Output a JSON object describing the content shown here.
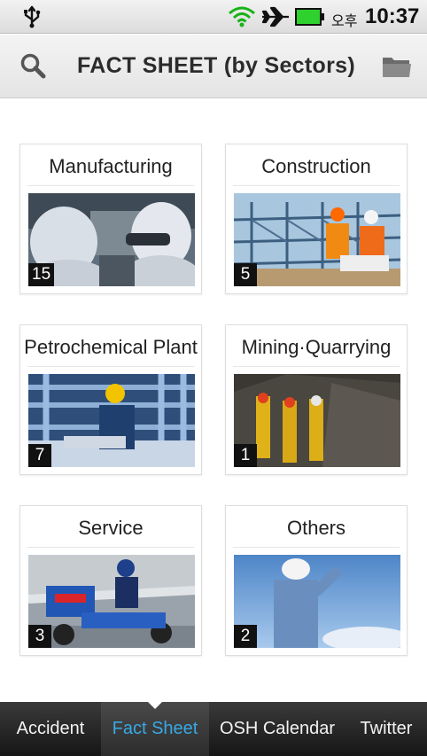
{
  "status_bar": {
    "ampm": "오후",
    "time": "10:37",
    "icons": [
      "usb-icon",
      "wifi-icon",
      "airplane-icon",
      "battery-icon"
    ]
  },
  "header": {
    "title": "FACT SHEET (by Sectors)",
    "icons": [
      "search-icon",
      "folder-icon"
    ]
  },
  "sectors": [
    {
      "label": "Manufacturing",
      "count": "15"
    },
    {
      "label": "Construction",
      "count": "5"
    },
    {
      "label": "Petrochemical Plant",
      "count": "7"
    },
    {
      "label": "Mining·Quarrying",
      "count": "1"
    },
    {
      "label": "Service",
      "count": "3"
    },
    {
      "label": "Others",
      "count": "2"
    }
  ],
  "tabs": [
    {
      "label": "Accident",
      "active": false
    },
    {
      "label": "Fact Sheet",
      "active": true
    },
    {
      "label": "OSH Calendar",
      "active": false
    },
    {
      "label": "Twitter",
      "active": false
    }
  ],
  "colors": {
    "active_tab_text": "#37a9e5",
    "tabbar_bg": "#1e1e1e",
    "battery_green": "#2fd12f"
  }
}
